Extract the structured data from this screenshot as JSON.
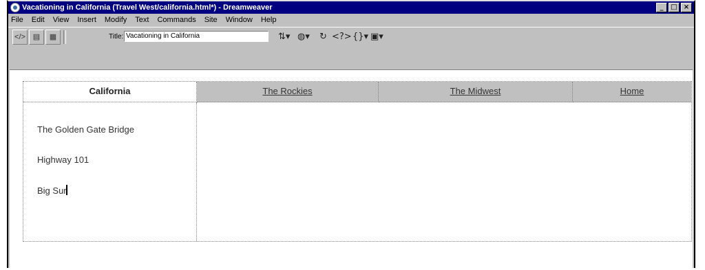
{
  "window": {
    "title": "Vacationing in California (Travel West/california.html*) - Dreamweaver",
    "controls": [
      "_",
      "□",
      "×"
    ]
  },
  "menu": [
    "File",
    "Edit",
    "View",
    "Insert",
    "Modify",
    "Text",
    "Commands",
    "Site",
    "Window",
    "Help"
  ],
  "toolbar": {
    "title_label": "Title:",
    "title_value": "Vacationing in California"
  },
  "page": {
    "nav": {
      "active": "California",
      "links": [
        "The Rockies",
        "The Midwest",
        "Home"
      ]
    },
    "sidebar": {
      "items": [
        "The Golden Gate Bridge",
        "Highway 101",
        "Big Sur"
      ]
    }
  }
}
